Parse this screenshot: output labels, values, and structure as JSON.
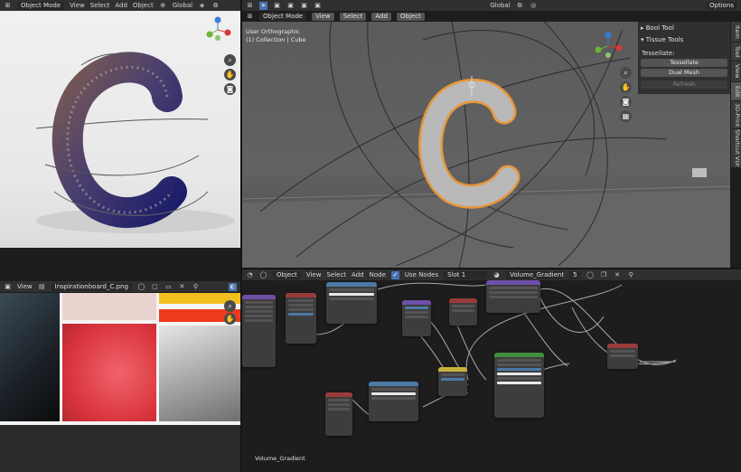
{
  "left_viewport_header": {
    "mode_label": "Object Mode",
    "menu": [
      "View",
      "Select",
      "Add",
      "Object"
    ],
    "transform_label": "Global"
  },
  "right_viewport_header": {
    "mode_label": "Object Mode",
    "menu": [
      "View",
      "Select",
      "Add",
      "Object"
    ],
    "transform_label": "Global",
    "options_label": "Options"
  },
  "viewport_overlay": {
    "view_name": "User Orthographic",
    "collection": "(1) Collection | Cube"
  },
  "n_panel": {
    "sections": [
      "Bool Tool",
      "Tissue Tools"
    ],
    "tessellate_label": "Tessellate:",
    "buttons": [
      "Tessellate",
      "Dual Mesh",
      "Refresh"
    ],
    "tabs": [
      "Item",
      "Tool",
      "View",
      "Edit",
      "3D-Print",
      "Shortcut VUr"
    ]
  },
  "image_editor_header": {
    "menu": [
      "View"
    ],
    "image_name": "Inspirationboard_C.png"
  },
  "node_editor_header": {
    "object_label": "Object",
    "menu": [
      "View",
      "Select",
      "Add",
      "Node"
    ],
    "use_nodes_label": "Use Nodes",
    "slot_label": "Slot 1",
    "material_name": "Volume_Gradient",
    "user_count": "5"
  },
  "node_editor_footer": {
    "material_label": "Volume_Gradient"
  },
  "colors": {
    "header": "#303030",
    "accent_orange": "#e8963a",
    "selected_blue": "#4772b3",
    "node_purple": "#6e4fa8",
    "node_blue": "#4c79a6",
    "node_green": "#3f8f3f",
    "node_red": "#9a3b3b"
  },
  "icons": [
    "editor-type-icon",
    "zoom-icon",
    "hand-icon",
    "camera-icon",
    "grid-icon",
    "pin-icon",
    "close-icon"
  ]
}
